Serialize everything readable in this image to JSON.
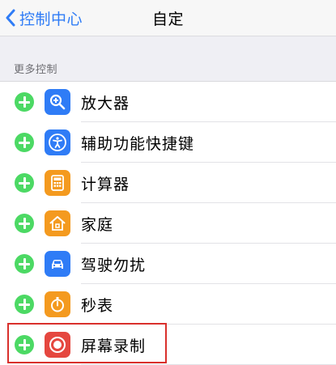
{
  "navbar": {
    "back_label": "控制中心",
    "title": "自定"
  },
  "section": {
    "header": "更多控制"
  },
  "items": [
    {
      "label": "放大器",
      "icon": "magnifier-icon",
      "color": "#2f7cf6"
    },
    {
      "label": "辅助功能快捷键",
      "icon": "accessibility-icon",
      "color": "#2f7cf6"
    },
    {
      "label": "计算器",
      "icon": "calculator-icon",
      "color": "#f49a1f"
    },
    {
      "label": "家庭",
      "icon": "home-icon",
      "color": "#f49a1f"
    },
    {
      "label": "驾驶勿扰",
      "icon": "car-icon",
      "color": "#2f7cf6"
    },
    {
      "label": "秒表",
      "icon": "stopwatch-icon",
      "color": "#f49a1f"
    },
    {
      "label": "屏幕录制",
      "icon": "screen-record-icon",
      "color": "#e5473f"
    }
  ],
  "colors": {
    "add_button": "#4cd964",
    "accent": "#2f7cf6",
    "highlight_box": "#d9302c"
  }
}
